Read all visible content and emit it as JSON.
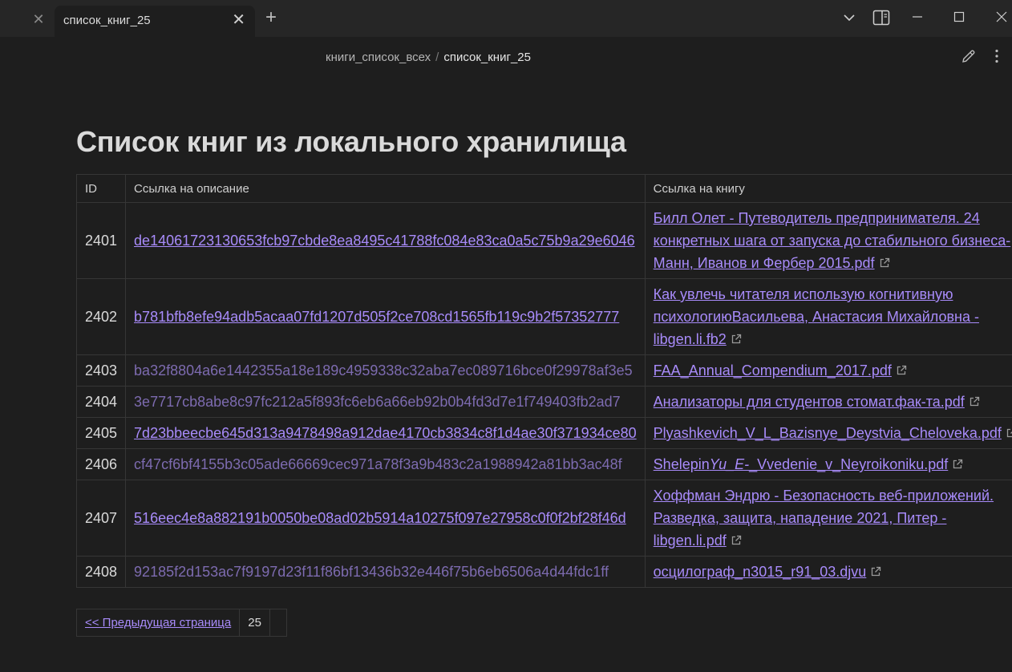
{
  "tabs": {
    "active_title": "список_книг_25"
  },
  "breadcrumb": {
    "parent": "книги_список_всех",
    "separator": "/",
    "current": "список_книг_25"
  },
  "page": {
    "title": "Список книг из локального хранилища"
  },
  "table": {
    "headers": [
      "ID",
      "Ссылка на описание",
      "Ссылка на книгу"
    ],
    "rows": [
      {
        "id": "2401",
        "desc": "de14061723130653fcb97cbde8ea8495c41788fc084e83ca0a5c75b9a29e6046",
        "desc_dim": false,
        "book": "Билл Олет - Путеводитель предпринимателя. 24 конкретных шага от запуска до стабильного бизнеса-Манн, Иванов и Фербер 2015.pdf",
        "wrap": true
      },
      {
        "id": "2402",
        "desc": "b781bfb8efe94adb5acaa07fd1207d505f2ce708cd1565fb119c9b2f57352777",
        "desc_dim": false,
        "book": "Как увлечь читателя использую когнитивную психологиюВасильева, Анастасия Михайловна - libgen.li.fb2",
        "wrap": true
      },
      {
        "id": "2403",
        "desc": "ba32f8804a6e1442355a18e189c4959338c32aba7ec089716bce0f29978af3e5",
        "desc_dim": true,
        "book": "FAA_Annual_Compendium_2017.pdf",
        "wrap": false
      },
      {
        "id": "2404",
        "desc": "3e7717cb8abe8c97fc212a5f893fc6eb6a66eb92b0b4fd3d7e1f749403fb2ad7",
        "desc_dim": true,
        "book": "Анализаторы для студентов стомат.фак-та.pdf",
        "wrap": false
      },
      {
        "id": "2405",
        "desc": "7d23bbeecbe645d313a9478498a912dae4170cb3834c8f1d4ae30f371934ce80",
        "desc_dim": false,
        "book": "Plyashkevich_V_L_Bazisnye_Deystvia_Cheloveka.pdf",
        "wrap": false
      },
      {
        "id": "2406",
        "desc": "cf47cf6bf4155b3c05ade66669cec971a78f3a9b483c2a1988942a81bb3ac48f",
        "desc_dim": true,
        "book": "Shelepin",
        "book_italic": "Yu_E-",
        "book_rest": "_Vvedenie_v_Neyroikoniku.pdf",
        "wrap": false
      },
      {
        "id": "2407",
        "desc": "516eec4e8a882191b0050be08ad02b5914a10275f097e27958c0f0f2bf28f46d",
        "desc_dim": false,
        "book": "Хоффман Эндрю - Безопасность веб-приложений. Разведка, защита, нападение 2021, Питер - libgen.li.pdf",
        "wrap": true
      },
      {
        "id": "2408",
        "desc": "92185f2d153ac7f9197d23f11f86bf13436b32e446f75b6eb6506a4d44fdc1ff",
        "desc_dim": true,
        "book": "осцилограф_n3015_r91_03.djvu",
        "wrap": false
      }
    ]
  },
  "pager": {
    "prev_label": "<< Предыдущая страница",
    "current_page": "25"
  },
  "colors": {
    "background": "#1e1e1e",
    "tabbar": "#262626",
    "link": "#a88bfa",
    "link_dim": "#7d6bb0",
    "border": "#363636"
  }
}
